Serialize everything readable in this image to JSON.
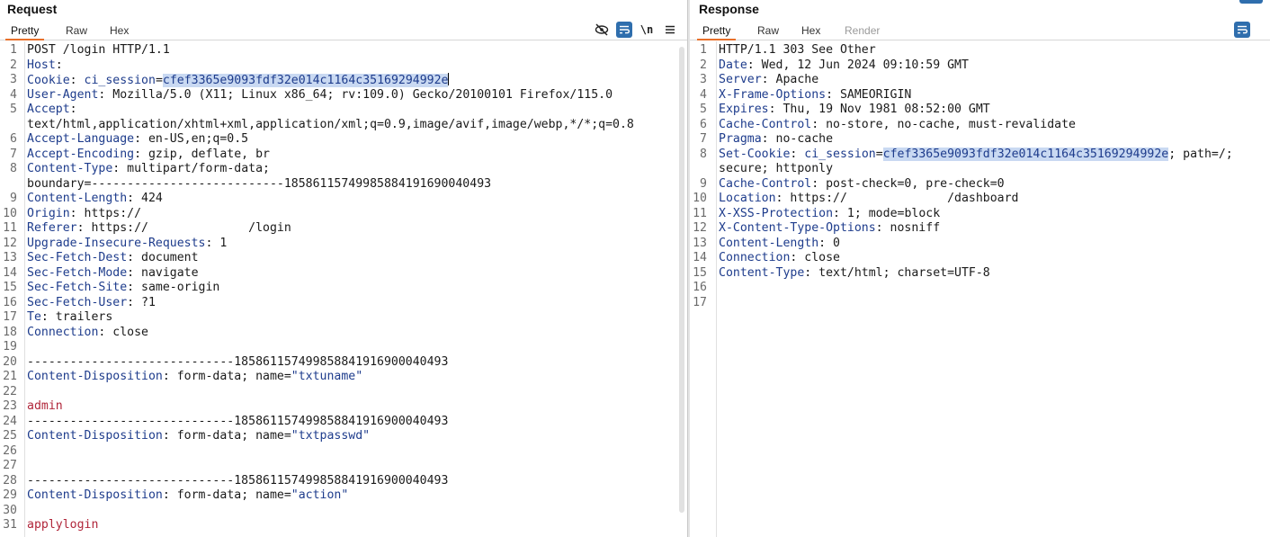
{
  "request": {
    "title": "Request",
    "tabs": [
      {
        "label": "Pretty",
        "active": true
      },
      {
        "label": "Raw"
      },
      {
        "label": "Hex"
      }
    ],
    "toolbar": {
      "hide_icon": "eye-slash-icon",
      "wrap_icon": "word-wrap-icon",
      "newline_label": "\\n",
      "menu_icon": "hamburger-menu-icon"
    }
  },
  "response": {
    "title": "Response",
    "tabs": [
      {
        "label": "Pretty",
        "active": true
      },
      {
        "label": "Raw"
      },
      {
        "label": "Hex"
      },
      {
        "label": "Render",
        "disabled": true
      }
    ],
    "toolbar": {
      "wrap_icon": "word-wrap-icon"
    }
  },
  "request_lines": [
    {
      "n": "1",
      "y": 0,
      "parts": [
        [
          "v",
          "POST /login HTTP/1.1"
        ]
      ]
    },
    {
      "n": "2",
      "y": 1,
      "parts": [
        [
          "k",
          "Host"
        ],
        [
          "v",
          ":"
        ]
      ]
    },
    {
      "n": "3",
      "y": 2,
      "parts": [
        [
          "k",
          "Cookie"
        ],
        [
          "v",
          ": "
        ],
        [
          "k",
          "ci_session"
        ],
        [
          "v",
          "="
        ],
        [
          "hl",
          "cfef3365e9093fdf32e014c1164c35169294992e"
        ]
      ],
      "caret": true
    },
    {
      "n": "4",
      "y": 3,
      "parts": [
        [
          "k",
          "User-Agent"
        ],
        [
          "v",
          ": Mozilla/5.0 (X11; Linux x86_64; rv:109.0) Gecko/20100101 Firefox/115.0"
        ]
      ]
    },
    {
      "n": "5",
      "y": 4,
      "parts": [
        [
          "k",
          "Accept"
        ],
        [
          "v",
          ":"
        ]
      ]
    },
    {
      "n": "",
      "y": 5,
      "parts": [
        [
          "v",
          "text/html,application/xhtml+xml,application/xml;q=0.9,image/avif,image/webp,*/*;q=0.8"
        ]
      ]
    },
    {
      "n": "6",
      "y": 6,
      "parts": [
        [
          "k",
          "Accept-Language"
        ],
        [
          "v",
          ": en-US,en;q=0.5"
        ]
      ]
    },
    {
      "n": "7",
      "y": 7,
      "parts": [
        [
          "k",
          "Accept-Encoding"
        ],
        [
          "v",
          ": gzip, deflate, br"
        ]
      ]
    },
    {
      "n": "8",
      "y": 8,
      "parts": [
        [
          "k",
          "Content-Type"
        ],
        [
          "v",
          ": multipart/form-data;"
        ]
      ]
    },
    {
      "n": "",
      "y": 9,
      "parts": [
        [
          "v",
          "boundary=---------------------------185861157499858841916900​40493"
        ]
      ]
    },
    {
      "n": "9",
      "y": 10,
      "parts": [
        [
          "k",
          "Content-Length"
        ],
        [
          "v",
          ": 424"
        ]
      ]
    },
    {
      "n": "10",
      "y": 11,
      "parts": [
        [
          "k",
          "Origin"
        ],
        [
          "v",
          ": https://"
        ]
      ]
    },
    {
      "n": "11",
      "y": 12,
      "parts": [
        [
          "k",
          "Referer"
        ],
        [
          "v",
          ": https://              /login"
        ]
      ]
    },
    {
      "n": "12",
      "y": 13,
      "parts": [
        [
          "k",
          "Upgrade-Insecure-Requests"
        ],
        [
          "v",
          ": 1"
        ]
      ]
    },
    {
      "n": "13",
      "y": 14,
      "parts": [
        [
          "k",
          "Sec-Fetch-Dest"
        ],
        [
          "v",
          ": document"
        ]
      ]
    },
    {
      "n": "14",
      "y": 15,
      "parts": [
        [
          "k",
          "Sec-Fetch-Mode"
        ],
        [
          "v",
          ": navigate"
        ]
      ]
    },
    {
      "n": "15",
      "y": 16,
      "parts": [
        [
          "k",
          "Sec-Fetch-Site"
        ],
        [
          "v",
          ": same-origin"
        ]
      ]
    },
    {
      "n": "16",
      "y": 17,
      "parts": [
        [
          "k",
          "Sec-Fetch-User"
        ],
        [
          "v",
          ": ?1"
        ]
      ]
    },
    {
      "n": "17",
      "y": 18,
      "parts": [
        [
          "k",
          "Te"
        ],
        [
          "v",
          ": trailers"
        ]
      ]
    },
    {
      "n": "18",
      "y": 19,
      "parts": [
        [
          "k",
          "Connection"
        ],
        [
          "v",
          ": close"
        ]
      ]
    },
    {
      "n": "19",
      "y": 20,
      "parts": []
    },
    {
      "n": "20",
      "y": 21,
      "parts": [
        [
          "v",
          "-----------------------------185861157499858841916900040493"
        ]
      ]
    },
    {
      "n": "21",
      "y": 22,
      "parts": [
        [
          "k",
          "Content-Disposition"
        ],
        [
          "v",
          ": form-data; name="
        ],
        [
          "s",
          "\"txtuname\""
        ]
      ]
    },
    {
      "n": "22",
      "y": 23,
      "parts": []
    },
    {
      "n": "23",
      "y": 24,
      "parts": [
        [
          "r",
          "admin"
        ]
      ]
    },
    {
      "n": "24",
      "y": 25,
      "parts": [
        [
          "v",
          "-----------------------------185861157499858841916900040493"
        ]
      ]
    },
    {
      "n": "25",
      "y": 26,
      "parts": [
        [
          "k",
          "Content-Disposition"
        ],
        [
          "v",
          ": form-data; name="
        ],
        [
          "s",
          "\"txtpasswd\""
        ]
      ]
    },
    {
      "n": "26",
      "y": 27,
      "parts": []
    },
    {
      "n": "27",
      "y": 28,
      "parts": []
    },
    {
      "n": "28",
      "y": 29,
      "parts": [
        [
          "v",
          "-----------------------------185861157499858841916900040493"
        ]
      ]
    },
    {
      "n": "29",
      "y": 30,
      "parts": [
        [
          "k",
          "Content-Disposition"
        ],
        [
          "v",
          ": form-data; name="
        ],
        [
          "s",
          "\"action\""
        ]
      ]
    },
    {
      "n": "30",
      "y": 31,
      "parts": []
    },
    {
      "n": "31",
      "y": 32,
      "parts": [
        [
          "r",
          "applylogin"
        ]
      ]
    }
  ],
  "response_lines": [
    {
      "n": "1",
      "y": 0,
      "parts": [
        [
          "v",
          "HTTP/1.1 303 See Other"
        ]
      ]
    },
    {
      "n": "2",
      "y": 1,
      "parts": [
        [
          "k",
          "Date"
        ],
        [
          "v",
          ": Wed, 12 Jun 2024 09:10:59 GMT"
        ]
      ]
    },
    {
      "n": "3",
      "y": 2,
      "parts": [
        [
          "k",
          "Server"
        ],
        [
          "v",
          ": Apache"
        ]
      ]
    },
    {
      "n": "4",
      "y": 3,
      "parts": [
        [
          "k",
          "X-Frame-Options"
        ],
        [
          "v",
          ": SAMEORIGIN"
        ]
      ]
    },
    {
      "n": "5",
      "y": 4,
      "parts": [
        [
          "k",
          "Expires"
        ],
        [
          "v",
          ": Thu, 19 Nov 1981 08:52:00 GMT"
        ]
      ]
    },
    {
      "n": "6",
      "y": 5,
      "parts": [
        [
          "k",
          "Cache-Control"
        ],
        [
          "v",
          ": no-store, no-cache, must-revalidate"
        ]
      ]
    },
    {
      "n": "7",
      "y": 6,
      "parts": [
        [
          "k",
          "Pragma"
        ],
        [
          "v",
          ": no-cache"
        ]
      ]
    },
    {
      "n": "8",
      "y": 7,
      "parts": [
        [
          "k",
          "Set-Cookie"
        ],
        [
          "v",
          ": "
        ],
        [
          "k",
          "ci_session"
        ],
        [
          "v",
          "="
        ],
        [
          "hl",
          "cfef3365e9093fdf32e014c1164c35169294992e"
        ],
        [
          "v",
          "; path=/;"
        ]
      ]
    },
    {
      "n": "",
      "y": 8,
      "parts": [
        [
          "v",
          "secure; httponly"
        ]
      ]
    },
    {
      "n": "9",
      "y": 9,
      "parts": [
        [
          "k",
          "Cache-Control"
        ],
        [
          "v",
          ": post-check=0, pre-check=0"
        ]
      ]
    },
    {
      "n": "10",
      "y": 10,
      "parts": [
        [
          "k",
          "Location"
        ],
        [
          "v",
          ": https://              /dashboard"
        ]
      ]
    },
    {
      "n": "11",
      "y": 11,
      "parts": [
        [
          "k",
          "X-XSS-Protection"
        ],
        [
          "v",
          ": 1; mode=block"
        ]
      ]
    },
    {
      "n": "12",
      "y": 12,
      "parts": [
        [
          "k",
          "X-Content-Type-Options"
        ],
        [
          "v",
          ": nosniff"
        ]
      ]
    },
    {
      "n": "13",
      "y": 13,
      "parts": [
        [
          "k",
          "Content-Length"
        ],
        [
          "v",
          ": 0"
        ]
      ]
    },
    {
      "n": "14",
      "y": 14,
      "parts": [
        [
          "k",
          "Connection"
        ],
        [
          "v",
          ": close"
        ]
      ]
    },
    {
      "n": "15",
      "y": 15,
      "parts": [
        [
          "k",
          "Content-Type"
        ],
        [
          "v",
          ": text/html; charset=UTF-8"
        ]
      ]
    },
    {
      "n": "16",
      "y": 16,
      "parts": []
    },
    {
      "n": "17",
      "y": 17,
      "parts": []
    }
  ]
}
